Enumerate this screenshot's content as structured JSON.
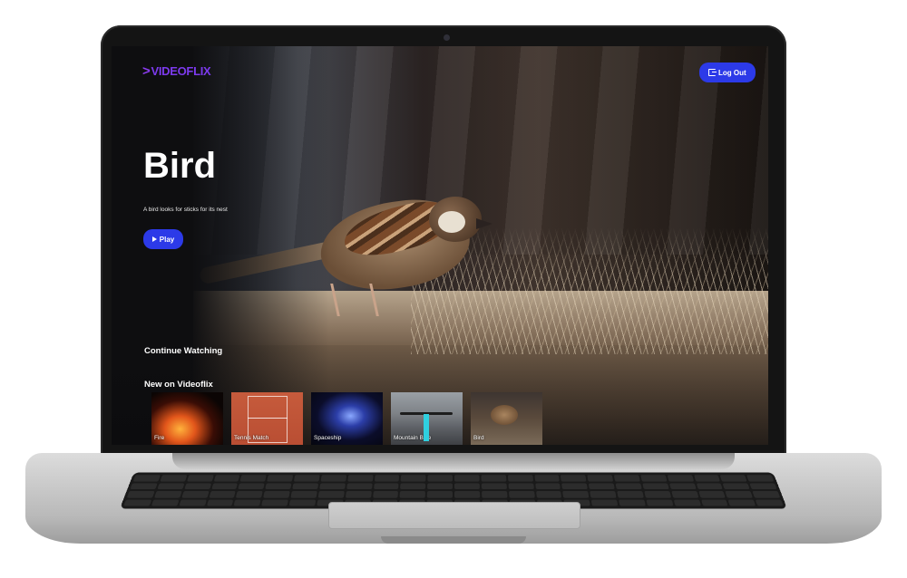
{
  "app": {
    "logo_text": "VIDEOFLIX",
    "logo_icon": "chevron-right-icon",
    "accent_color": "#2c3ae8",
    "brand_color": "#7c3aed"
  },
  "header": {
    "logout_label": "Log Out",
    "logout_icon": "logout-icon"
  },
  "hero": {
    "title": "Bird",
    "description": "A bird looks for sticks for its nest",
    "play_label": "Play",
    "play_icon": "play-icon"
  },
  "sections": {
    "continue_watching": "Continue Watching",
    "new_on": "New on Videoflix"
  },
  "new_on_videoflix": [
    {
      "title": "Fire"
    },
    {
      "title": "Tennis Match"
    },
    {
      "title": "Spaceship"
    },
    {
      "title": "Mountain Bike"
    },
    {
      "title": "Bird"
    }
  ]
}
